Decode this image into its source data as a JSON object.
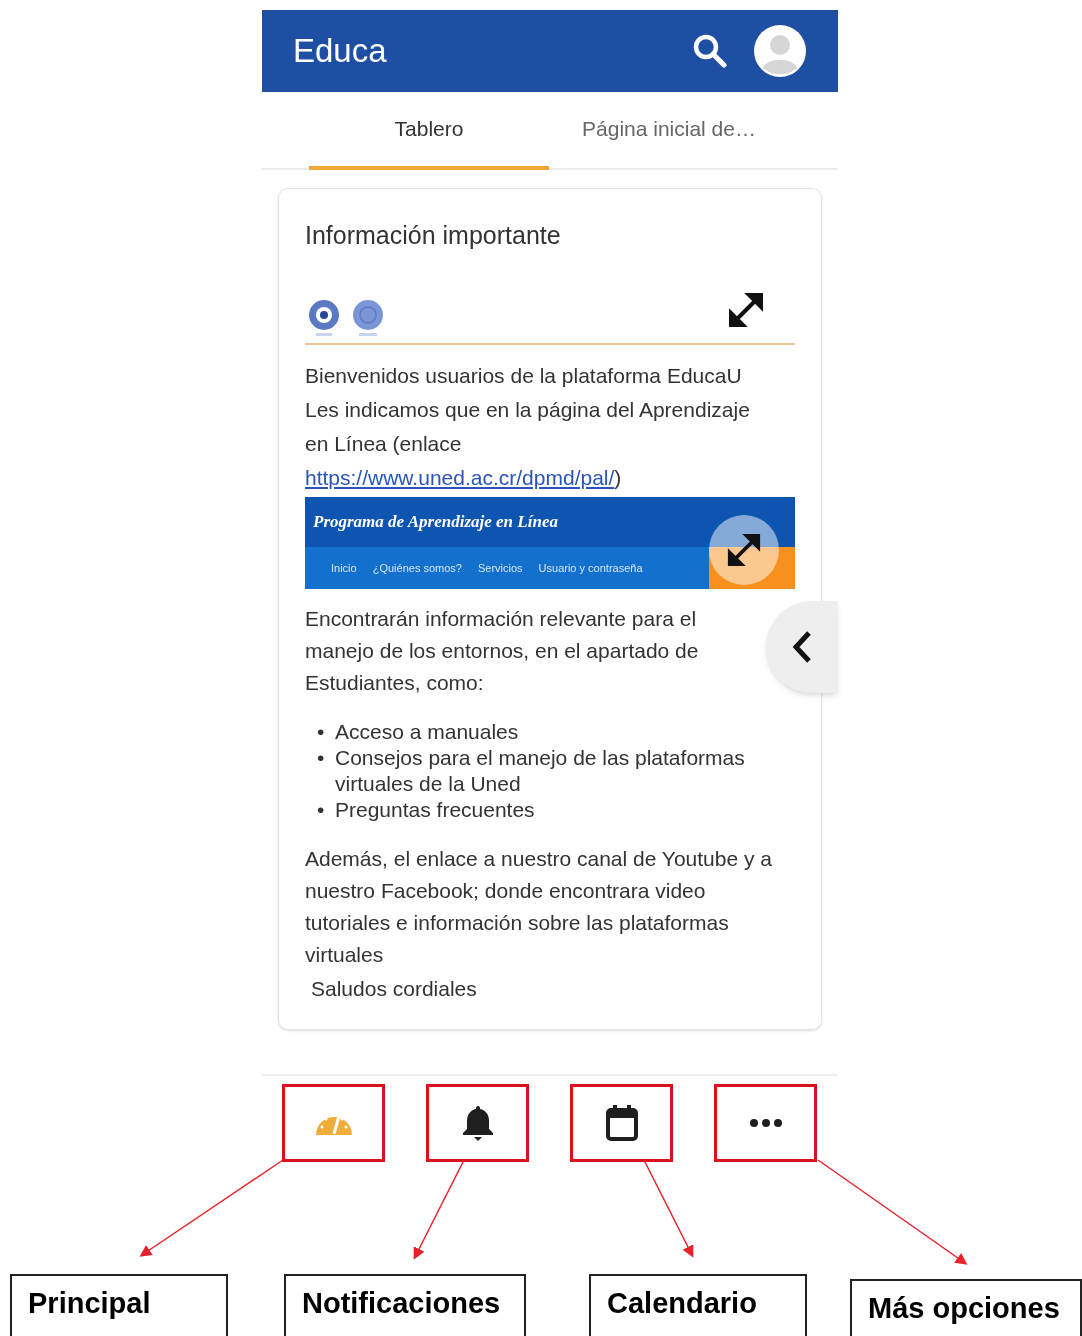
{
  "header": {
    "title": "Educa"
  },
  "tabs": [
    {
      "label": "Tablero",
      "selected": true
    },
    {
      "label": "Página inicial de…",
      "selected": false
    }
  ],
  "card": {
    "title": "Información importante",
    "intro": [
      "Bienvenidos usuarios de la plataforma EducaU"
    ],
    "link_sentence": {
      "before": "Les indicamos que en la página del Aprendizaje en Línea (enlace",
      "link": "https://www.uned.ac.cr/dpmd/pal/",
      "after": ")"
    },
    "banner": {
      "title": "Programa de Aprendizaje en Línea",
      "menu": [
        "Inicio",
        "¿Quiénes somos?",
        "Servicios",
        "Usuario y contraseña"
      ]
    },
    "paragraph": "Encontrarán información relevante para el manejo de los entornos, en el apartado de Estudiantes, como:",
    "bullet_mark": "•",
    "bullets": [
      "Acceso a manuales",
      "Consejos para el manejo de las plataformas virtuales de la Uned",
      "Preguntas frecuentes"
    ],
    "closing": "Además, el enlace a nuestro canal de Youtube y a nuestro Facebook; donde encontrara video tutoriales e información sobre las plataformas virtuales",
    "signature": "Saludos cordiales"
  },
  "bottom_nav": [
    {
      "kind": "dashboard",
      "selected": true
    },
    {
      "kind": "bell",
      "selected": false
    },
    {
      "kind": "calendar",
      "selected": false
    },
    {
      "kind": "more",
      "selected": false
    }
  ],
  "annotations": [
    "Principal",
    "Notificaciones",
    "Calendario",
    "Más opciones"
  ]
}
